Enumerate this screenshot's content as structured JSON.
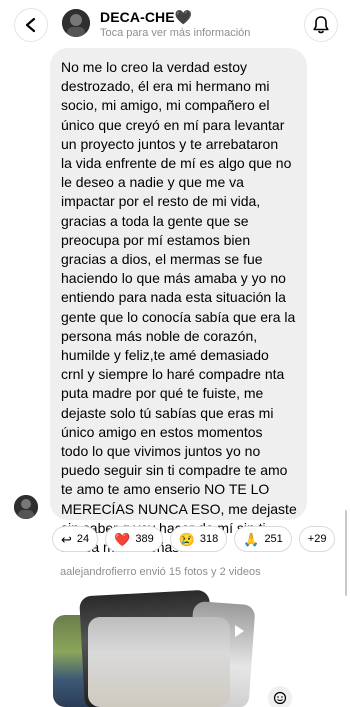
{
  "header": {
    "title": "DECA-CHE🖤",
    "subtitle": "Toca para ver más información"
  },
  "message": {
    "text": "No me lo creo la verdad estoy\ndestrozado, él era mi hermano mi\nsocio, mi amigo, mi compañero el\núnico que creyó en mí para levantar\nun proyecto juntos y te arrebataron\nla vida enfrente de mí es algo que no\nle deseo a nadie y que me va\nimpactar por el resto de mi vida,\ngracias a toda la gente que se\npreocupa por mí estamos bien\ngracias a dios, el mermas se fue\nhaciendo lo que más amaba y yo no\nentiendo para nada esta situación la\ngente que lo conocía sabía que era la\npersona más noble de corazón,\nhumilde y feliz,te amé demasiado\ncrnl y siempre lo haré compadre nta\nputa madre por qué te fuiste, me\ndejaste solo tú sabías que eras mi\núnico amigo en estos momentos\ntodo lo que vivimos juntos yo no\npuedo seguir sin ti compadre te amo\nte amo te amo enserio NO TE LO\nMERECÍAS NUNCA ESO, me dejaste\nsin saber q voy hacer de mí sin ti\nnunca me enseñaste eso"
  },
  "reactions": [
    {
      "icon": "reply-icon",
      "glyph": "↩",
      "count": "24"
    },
    {
      "icon": "heart-icon",
      "glyph": "❤️",
      "count": "389"
    },
    {
      "icon": "sad-face-icon",
      "glyph": "😢",
      "count": "318"
    },
    {
      "icon": "praying-hands-icon",
      "glyph": "🙏",
      "count": "251"
    },
    {
      "icon": "more-reactions",
      "glyph": "",
      "count": "+29"
    }
  ],
  "sent_note": "aalejandrofierro envió 15 fotos y 2 videos",
  "colors": {
    "bubble": "#efefef",
    "muted_text": "#8e8e8e",
    "border": "#dbdbdb"
  }
}
